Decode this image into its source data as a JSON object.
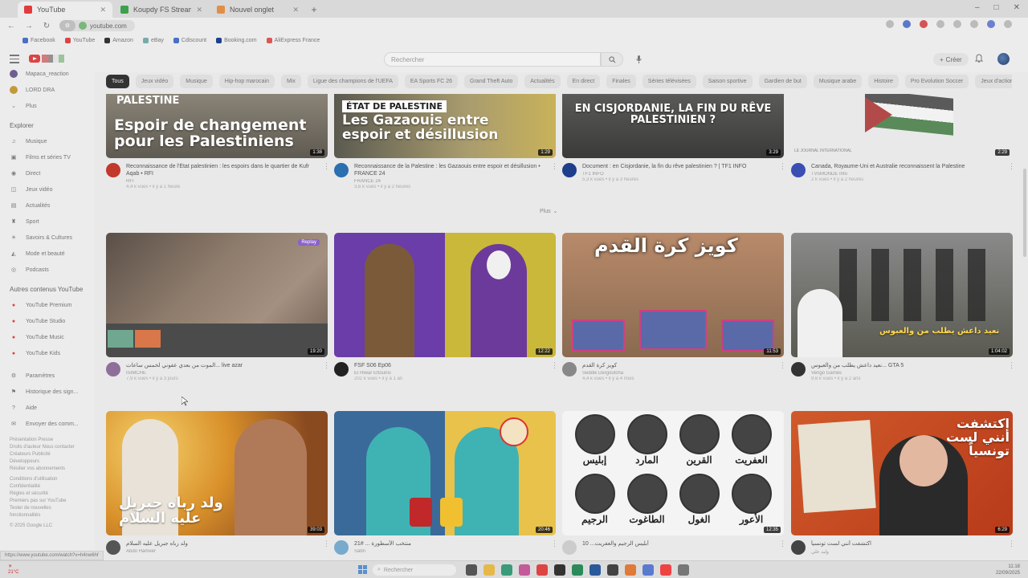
{
  "browser": {
    "tabs": [
      {
        "title": "YouTube",
        "favicon_color": "#e23b3b",
        "active": true
      },
      {
        "title": "Koupdy FS Stream - Watch Li",
        "favicon_color": "#3da14b",
        "active": false
      },
      {
        "title": "Nouvel onglet",
        "favicon_color": "#e08f48",
        "active": false
      }
    ],
    "new_tab_label": "+",
    "url": "youtube.com",
    "window_controls": [
      "–",
      "□",
      "✕"
    ],
    "bookmarks": [
      "Facebook",
      "YouTube",
      "Amazon",
      "eBay",
      "Cdiscount",
      "Booking.com",
      "AliExpress France"
    ]
  },
  "header": {
    "search_placeholder": "Rechercher",
    "create_label": "Créer",
    "brand_color": "#e23b3b"
  },
  "sidebar": {
    "top_items": [
      {
        "label": "Mapaca_reaction"
      },
      {
        "label": "LORD DRA"
      },
      {
        "label": "Plus"
      }
    ],
    "explore_title": "Explorer",
    "explore_items": [
      {
        "label": "Musique",
        "icon": "music-icon"
      },
      {
        "label": "Films et séries TV",
        "icon": "film-icon"
      },
      {
        "label": "Direct",
        "icon": "live-icon"
      },
      {
        "label": "Jeux vidéo",
        "icon": "gamepad-icon"
      },
      {
        "label": "Actualités",
        "icon": "news-icon"
      },
      {
        "label": "Sport",
        "icon": "trophy-icon"
      },
      {
        "label": "Savoirs & Cultures",
        "icon": "bulb-icon"
      },
      {
        "label": "Mode et beauté",
        "icon": "hanger-icon"
      },
      {
        "label": "Podcasts",
        "icon": "podcast-icon"
      }
    ],
    "other_title": "Autres contenus YouTube",
    "other_items": [
      {
        "label": "YouTube Premium"
      },
      {
        "label": "YouTube Studio"
      },
      {
        "label": "YouTube Music"
      },
      {
        "label": "YouTube Kids"
      }
    ],
    "settings_items": [
      {
        "label": "Paramètres",
        "icon": "gear-icon"
      },
      {
        "label": "Historique des sign...",
        "icon": "flag-icon"
      },
      {
        "label": "Aide",
        "icon": "help-icon"
      },
      {
        "label": "Envoyer des comm...",
        "icon": "feedback-icon"
      }
    ],
    "footer_lines": [
      "Présentation  Presse",
      "Droits d'auteur  Nous contacter",
      "Créateurs  Publicité",
      "Développeurs",
      "Résilier vos abonnements",
      "",
      "Conditions d'utilisation",
      "Confidentialité",
      "Règles et sécurité",
      "Premiers pas sur YouTube",
      "Tester de nouvelles",
      "fonctionnalités",
      "",
      "© 2025 Google LLC"
    ]
  },
  "chips": [
    "Tous",
    "Jeux vidéo",
    "Musique",
    "Hip-hop marocain",
    "Mix",
    "Ligue des champions de l'UEFA",
    "EA Sports FC 26",
    "Grand Theft Auto",
    "Actualités",
    "En direct",
    "Finales",
    "Séries télévisées",
    "Saison sportive",
    "Gardien de but",
    "Musique arabe",
    "Histoire",
    "Pro Evolution Soccer",
    "Jeux d'action et d'aventure"
  ],
  "news_row": [
    {
      "title": "Reconnaissance de l'État palestinien : les espoirs dans le quartier de Kufr Aqab • RFI",
      "channel": "RFI",
      "stats": "4,4 k vues • il y a 1 heure",
      "duration": "1:38",
      "tag": "PALESTINE",
      "caption": "Espoir de changement pour les Palestiniens",
      "avatar_color": "#c0392b"
    },
    {
      "title": "Reconnaissance de la Palestine : les Gazaouis entre espoir et désillusion • FRANCE 24",
      "channel": "FRANCE 24",
      "stats": "3,6 k vues • il y a 2 heures",
      "duration": "1:29",
      "tag": "ÉTAT DE PALESTINE",
      "caption": "Les Gazaouis entre espoir et désillusion",
      "avatar_color": "#2a6fb0"
    },
    {
      "title": "Document : en Cisjordanie, la fin du rêve palestinien ? | TF1 INFO",
      "channel": "TF1 INFO",
      "stats": "5,3 k vues • il y a 3 heures",
      "duration": "3:29",
      "tag": "",
      "caption": "EN CISJORDANIE, LA FIN DU RÊVE PALESTINIEN ?",
      "avatar_color": "#1d3e8a"
    },
    {
      "title": "Canada, Royaume-Uni et Australie reconnaissent la Palestine",
      "channel": "TV5MONDE Info",
      "stats": "2 k vues • il y a 2 heures",
      "duration": "2:29",
      "tag": "",
      "caption": "LE JOURNAL INTERNATIONAL",
      "avatar_color": "#3b4fb3"
    }
  ],
  "plus_label": "Plus",
  "videos": [
    {
      "title": "الموت من بعدي عفوني لخمس ساعات... live azar",
      "channel": "ISIMCHE",
      "stats": "7,9 k vues • il y a 3 jours",
      "duration": "19:20",
      "badge": "Replay",
      "avatar_color": "#8e6f9a"
    },
    {
      "title": "FSF S06 Ep06",
      "channel": "El Hiwar Ettounsi",
      "stats": "202 k vues • il y a 1 an",
      "duration": "12:22",
      "badge": "",
      "avatar_color": "#222222"
    },
    {
      "title": "كويز كرة القدم",
      "channel": "Seddik Dergoutcha",
      "stats": "4,4 k vues • il y a 4 mois",
      "duration": "11:53",
      "caption": "كويز كرة القدم",
      "badge": "",
      "avatar_color": "#888888"
    },
    {
      "title": "نعيد داعش يطلب من والعبوس... GTA 5",
      "channel": "Vengo Games",
      "stats": "9,6 k vues • il y a 2 ans",
      "duration": "1:04:02",
      "caption": "نعيد داعش يطلب من والعبوس",
      "badge": "",
      "avatar_color": "#333333"
    },
    {
      "title": "ولد رباه جبريل عليه السلام",
      "channel": "Abdo Hameer",
      "stats": "",
      "duration": "39:03",
      "caption": "ولد رباه جبريل عليه السلام",
      "badge": "",
      "avatar_color": "#555555"
    },
    {
      "title": "منتخب الأسطورة ... #21",
      "channel": "Sabri",
      "stats": "",
      "duration": "20:46",
      "badge": "",
      "avatar_color": "#77aacc"
    },
    {
      "title": "أبليس الرجيم والعفريت... 10",
      "channel": "",
      "stats": "",
      "duration": "12:35",
      "names": [
        "إبليس",
        "المارد",
        "القرين",
        "العفريت",
        "الرجيم",
        "الطاغوت",
        "الغول",
        "الأعور"
      ],
      "badge": "",
      "avatar_color": "#cccccc"
    },
    {
      "title": "اكتشفت أنني لست تونسياً",
      "channel": "وليد علي",
      "stats": "",
      "duration": "6:29",
      "caption": "اكتشفت أنني لست تونسياً",
      "badge": "",
      "avatar_color": "#444444"
    }
  ],
  "status_url": "https://www.youtube.com/watch?v=h4nw6hf",
  "taskbar": {
    "search_placeholder": "Rechercher",
    "time": "11:18",
    "date": "22/09/2025",
    "weather": "21°C"
  }
}
